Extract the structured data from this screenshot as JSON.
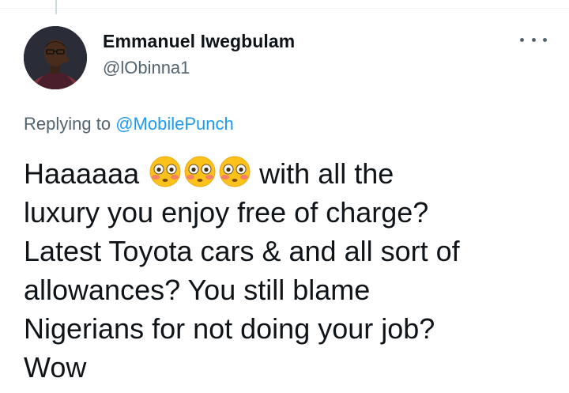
{
  "tweet": {
    "author": {
      "display_name": "Emmanuel Iwegbulam",
      "handle": "@lObinna1"
    },
    "replying_prefix": "Replying to",
    "replying_to": "@MobilePunch",
    "text_lines": {
      "l1_start": "Haaaaaa",
      "l1_end": "with all the",
      "l2": "luxury you enjoy free of charge?",
      "l3": "Latest Toyota cars & and all sort of",
      "l4": "allowances? You still blame",
      "l5": "Nigerians for not doing your job?",
      "l6": "Wow"
    },
    "emoji": [
      "flushed-face-emoji",
      "flushed-face-emoji",
      "flushed-face-emoji"
    ]
  },
  "colors": {
    "text_primary": "#0f1419",
    "text_secondary": "#536471",
    "link": "#1d9bf0",
    "background": "#ffffff"
  },
  "icons": {
    "more": "more-horizontal-icon",
    "avatar": "avatar-photo"
  }
}
